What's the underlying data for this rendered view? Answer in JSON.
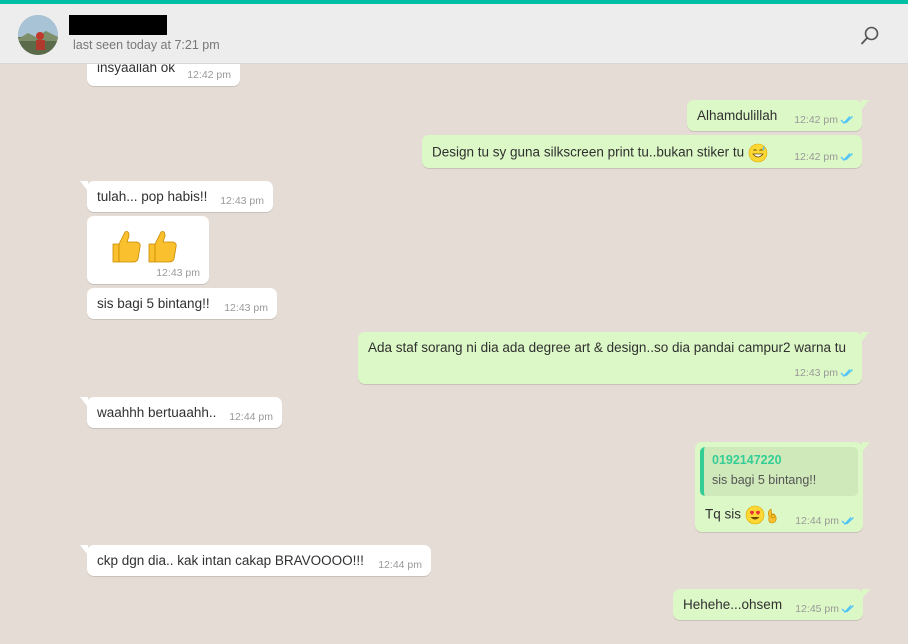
{
  "header": {
    "status": "last seen today at 7:21 pm"
  },
  "icons": {
    "search": "search-icon",
    "read_receipt": "double-check-icon"
  },
  "colors": {
    "accent": "#00bfa5",
    "incoming": "#ffffff",
    "outgoing": "#dcf8c6",
    "background": "#e5ddd5",
    "tick_read": "#4fc3f7"
  },
  "messages": [
    {
      "direction": "in",
      "text": "insyaallah ok",
      "time": "12:42 pm"
    },
    {
      "direction": "out",
      "text": "Alhamdulillah",
      "time": "12:42 pm"
    },
    {
      "direction": "out",
      "text": "Design tu sy guna silkscreen print tu..bukan stiker tu",
      "emoji": "grinning-sweat-emoji",
      "time": "12:42 pm"
    },
    {
      "direction": "in",
      "text": "tulah... pop habis!!",
      "time": "12:43 pm"
    },
    {
      "direction": "in",
      "emoji": "thumbs-up-emoji x2",
      "time": "12:43 pm"
    },
    {
      "direction": "in",
      "text": "sis bagi 5 bintang!!",
      "time": "12:43 pm"
    },
    {
      "direction": "out",
      "text": "Ada staf sorang ni dia ada degree art & design..so dia pandai campur2 warna tu",
      "time": "12:43 pm"
    },
    {
      "direction": "in",
      "text": "waahhh bertuaahh..",
      "time": "12:44 pm"
    },
    {
      "direction": "out",
      "quote_name": "0192147220",
      "quote_text": "sis bagi 5 bintang!!",
      "text": "Tq sis",
      "emoji": "heart-eyes-ok-hand-emoji",
      "time": "12:44 pm"
    },
    {
      "direction": "in",
      "text": "ckp dgn dia.. kak intan cakap BRAVOOOO!!!",
      "time": "12:44 pm"
    },
    {
      "direction": "out",
      "text": "Hehehe...ohsem",
      "time": "12:45 pm"
    }
  ]
}
